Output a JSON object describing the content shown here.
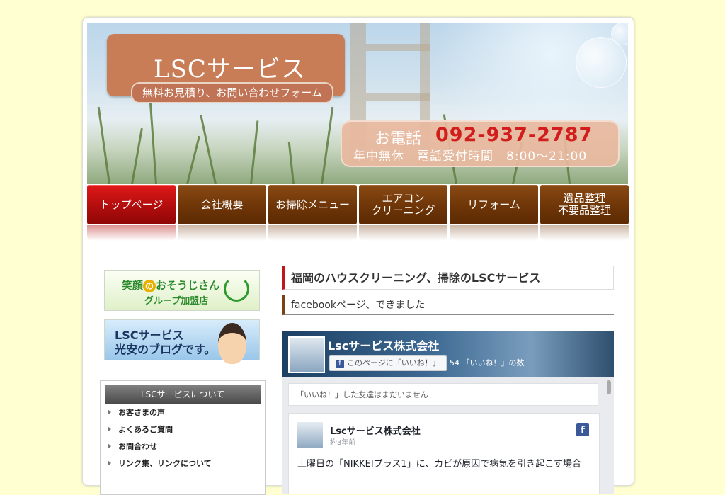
{
  "header": {
    "logo_title": "LSCサービス",
    "logo_subtitle": "無料お見積り、お問い合わせフォーム",
    "phone_label": "お電話",
    "phone_number": "092-937-2787",
    "phone_hours": "年中無休　電話受付時間　8:00～21:00"
  },
  "nav": {
    "items": [
      {
        "label": "トップページ",
        "active": true
      },
      {
        "label": "会社概要"
      },
      {
        "label": "お掃除メニュー"
      },
      {
        "label": "エアコン\nクリーニング"
      },
      {
        "label": "リフォーム"
      },
      {
        "label": "遺品整理\n不要品整理"
      }
    ]
  },
  "sidebar": {
    "banner1_line1_a": "笑顔",
    "banner1_line1_o": "の",
    "banner1_line1_b": "おそうじさん",
    "banner1_line2": "グループ加盟店",
    "banner2_line1": "LSCサービス",
    "banner2_line2": "光安のブログです。",
    "box_title": "LSCサービスについて",
    "links": [
      "お客さまの声",
      "よくあるご質問",
      "お問合わせ",
      "リンク集、リンクについて"
    ]
  },
  "main": {
    "heading": "福岡のハウスクリーニング、掃除のLSCサービス",
    "subheading": "facebookページ、できました"
  },
  "facebook": {
    "page_name": "Lscサービス株式会社",
    "like_button": "このページに「いいね！」",
    "like_count": "54 「いいね！」の数",
    "friends_text": "「いいね！」した友達はまだいません",
    "post_author": "Lscサービス株式会社",
    "post_time": "約3年前",
    "post_text": "土曜日の「NIKKEIプラス1」に、カビが原因で病気を引き起こす場合"
  },
  "colors": {
    "page_bg": "#ffffd2",
    "nav_brown": "#6e3507",
    "nav_active_red": "#b20d0d",
    "phone_red": "#d21d1d",
    "logo_box": "#c97d57",
    "facebook_blue": "#3b5998"
  }
}
